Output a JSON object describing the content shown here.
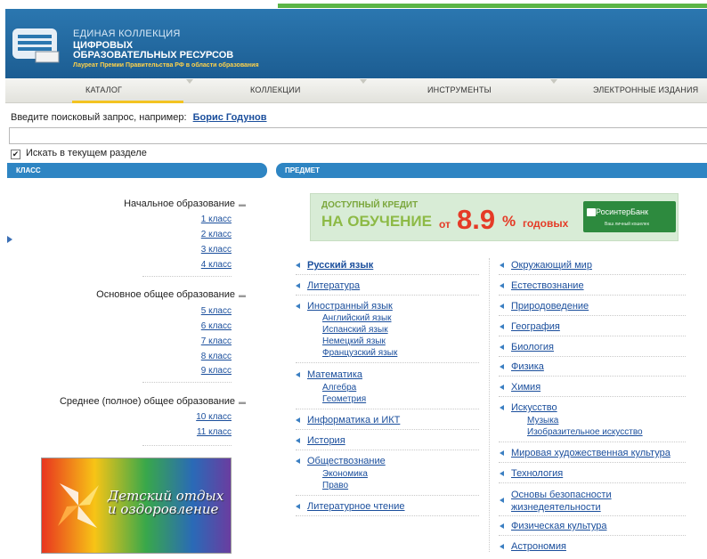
{
  "header": {
    "line1": "ЕДИНАЯ КОЛЛЕКЦИЯ",
    "line2": "ЦИФРОВЫХ",
    "line3": "ОБРАЗОВАТЕЛЬНЫХ РЕСУРСОВ",
    "line4": "Лауреат Премии Правительства РФ в области образования"
  },
  "nav": {
    "items": [
      "КАТАЛОГ",
      "КОЛЛЕКЦИИ",
      "ИНСТРУМЕНТЫ",
      "ЭЛЕКТРОННЫЕ ИЗДАНИЯ"
    ]
  },
  "search": {
    "hint": "Введите поисковый запрос, например:",
    "example": "Борис Годунов",
    "value": "",
    "checkbox_label": "Искать в текущем разделе",
    "checked": true
  },
  "left_panel": {
    "title": "КЛАСС",
    "sections": [
      {
        "title": "Начальное образование",
        "items": [
          "1 класс",
          "2 класс",
          "3 класс",
          "4 класс"
        ]
      },
      {
        "title": "Основное общее образование",
        "items": [
          "5 класс",
          "6 класс",
          "7 класс",
          "8 класс",
          "9 класс"
        ]
      },
      {
        "title": "Среднее (полное) общее образование",
        "items": [
          "10 класс",
          "11 класс"
        ]
      }
    ],
    "promo": {
      "line1": "Детский отдых",
      "line2": "и оздоровление"
    }
  },
  "right_panel": {
    "title": "ПРЕДМЕТ",
    "banner": {
      "line1": "ДОСТУПНЫЙ КРЕДИТ",
      "line2": "НА ОБУЧЕНИЕ",
      "from": "от",
      "rate": "8.9",
      "percent": "%",
      "suffix": "годовых",
      "bank": "РосинтерБанк",
      "bank_sub": "Ваш личный кошелек"
    },
    "col1": [
      {
        "label": "Русский язык",
        "subs": []
      },
      {
        "label": "Литература",
        "subs": []
      },
      {
        "label": "Иностранный язык",
        "subs": [
          "Английский язык",
          "Испанский язык",
          "Немецкий язык",
          "Французский язык"
        ]
      },
      {
        "label": "Математика",
        "subs": [
          "Алгебра",
          "Геометрия"
        ]
      },
      {
        "label": "Информатика и ИКТ",
        "subs": []
      },
      {
        "label": "История",
        "subs": []
      },
      {
        "label": "Обществознание",
        "subs": [
          "Экономика",
          "Право"
        ]
      },
      {
        "label": "Литературное чтение",
        "subs": []
      }
    ],
    "col2": [
      {
        "label": "Окружающий мир",
        "subs": []
      },
      {
        "label": "Естествознание",
        "subs": []
      },
      {
        "label": "Природоведение",
        "subs": []
      },
      {
        "label": "География",
        "subs": []
      },
      {
        "label": "Биология",
        "subs": []
      },
      {
        "label": "Физика",
        "subs": []
      },
      {
        "label": "Химия",
        "subs": []
      },
      {
        "label": "Искусство",
        "subs": [
          "Музыка",
          "Изобразительное искусство"
        ]
      },
      {
        "label": "Мировая художественная культура",
        "subs": []
      },
      {
        "label": "Технология",
        "subs": []
      },
      {
        "label": "Основы безопасности жизнедеятельности",
        "subs": []
      },
      {
        "label": "Физическая культура",
        "subs": []
      },
      {
        "label": "Астрономия",
        "subs": []
      }
    ]
  },
  "colors": {
    "header_blue": "#1c5d92",
    "panel_blue": "#2e85c3",
    "link": "#1a4e9c",
    "accent_yellow": "#f3c321",
    "green_line": "#5bb546"
  }
}
